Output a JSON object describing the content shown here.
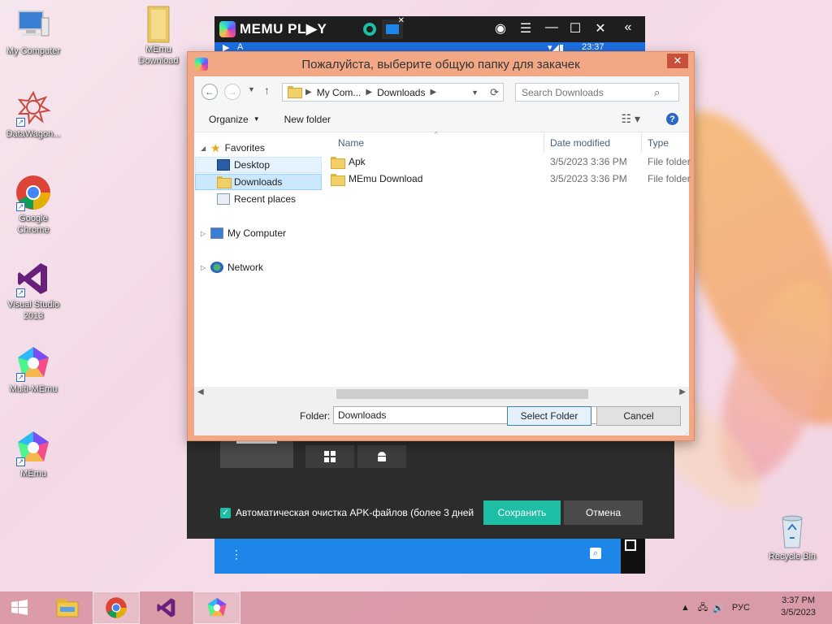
{
  "desktop": {
    "icons": [
      {
        "label": "My Computer"
      },
      {
        "label": "MEmu\nDownload"
      },
      {
        "label": "DataWagon..."
      },
      {
        "label": "Google\nChrome"
      },
      {
        "label": "Visual Studio\n2013"
      },
      {
        "label": "Multi-MEmu"
      },
      {
        "label": "MEmu"
      },
      {
        "label": "Recycle Bin"
      }
    ]
  },
  "memu": {
    "brand": "MEMU PL▶Y",
    "status_time": "23:37"
  },
  "settings_panel": {
    "apk_cleanup_label": "Автоматическая очистка APK-файлов (более 3 дней",
    "save_label": "Сохранить",
    "cancel_label": "Отмена"
  },
  "dialog": {
    "title": "Пожалуйста, выберите общую папку для закачек",
    "address_crumbs": [
      "My Com...",
      "Downloads"
    ],
    "search_placeholder": "Search Downloads",
    "toolbar": {
      "organize_label": "Organize",
      "new_folder_label": "New folder"
    },
    "nav": {
      "favorites_label": "Favorites",
      "desktop_label": "Desktop",
      "downloads_label": "Downloads",
      "recent_label": "Recent places",
      "computer_label": "My Computer",
      "network_label": "Network"
    },
    "columns": {
      "name": "Name",
      "date_modified": "Date modified",
      "type": "Type"
    },
    "files": [
      {
        "name": "Apk",
        "date": "3/5/2023 3:36 PM",
        "type": "File folder"
      },
      {
        "name": "MEmu Download",
        "date": "3/5/2023 3:36 PM",
        "type": "File folder"
      }
    ],
    "folder_label": "Folder:",
    "folder_value": "Downloads",
    "select_folder_label": "Select Folder",
    "cancel_label": "Cancel"
  },
  "taskbar": {
    "language": "РУС",
    "time": "3:37 PM",
    "date": "3/5/2023"
  }
}
